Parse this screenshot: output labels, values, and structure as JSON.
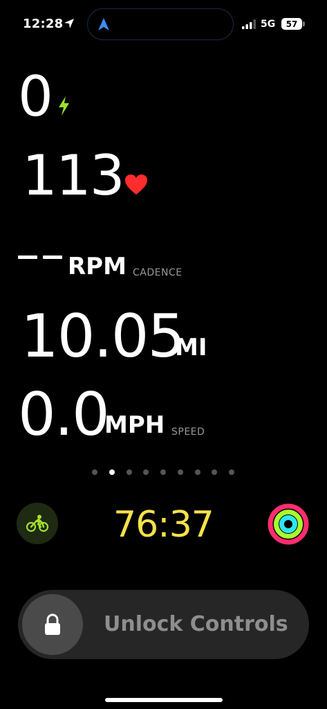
{
  "status_bar": {
    "time": "12:28",
    "network": "5G",
    "battery": "57"
  },
  "metrics": {
    "power": {
      "value": "0"
    },
    "heart_rate": {
      "value": "113"
    },
    "cadence": {
      "unit": "RPM",
      "label": "CADENCE"
    },
    "distance": {
      "value": "10.05",
      "unit": "MI"
    },
    "speed": {
      "value": "0.0",
      "unit": "MPH",
      "label": "SPEED"
    }
  },
  "pager": {
    "page_count": 9,
    "active_index": 1
  },
  "bottom_row": {
    "workout_icon": "cycling-icon",
    "elapsed_time": "76:37",
    "rings_icon": "activity-rings-icon"
  },
  "unlock": {
    "label": "Unlock Controls"
  },
  "colors": {
    "power_accent": "#9be02a",
    "heart": "#ff2d2d",
    "timer": "#f5e24a",
    "cycling_green": "#a6e22e"
  }
}
